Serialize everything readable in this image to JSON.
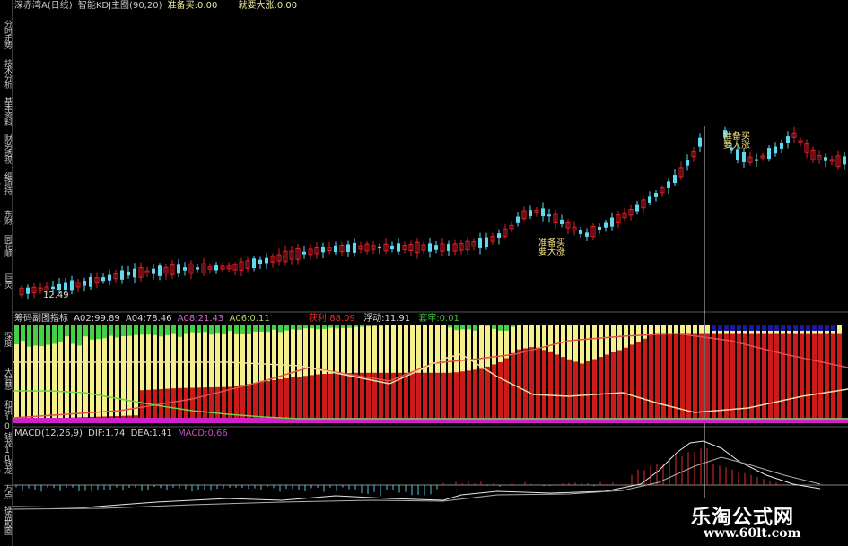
{
  "sidebar": {
    "items": [
      {
        "label": "分时走势"
      },
      {
        "label": "技术分析"
      },
      {
        "label": "基本资料"
      },
      {
        "label": "财务透视"
      },
      {
        "label": "细项持10"
      },
      {
        "label": "东财10"
      },
      {
        "label": "同花顺10"
      },
      {
        "label": "巨灵10"
      },
      {
        "label": "深度F10"
      },
      {
        "label": "大智慧"
      },
      {
        "label": "和讯10"
      },
      {
        "label": "钱龙10"
      },
      {
        "label": "钱龙10"
      },
      {
        "label": "万点"
      },
      {
        "label": "操盘股圈"
      }
    ]
  },
  "main_header": {
    "stock": "深赤湾A",
    "period": "(日线)",
    "indicator": "智能KDJ主图(90,20)",
    "buy_label": "准备买:",
    "buy_value": "0.00",
    "surge_label": "就要大涨:",
    "surge_value": "0.00"
  },
  "main_chart": {
    "price_low_label": "12.49",
    "signal_buy": "准备买",
    "signal_surge": "要大涨"
  },
  "chip_header": {
    "title": "筹码副图指标",
    "a02_label": "A02:",
    "a02_value": "99.89",
    "a04_label": "A04:",
    "a04_value": "78.46",
    "a08_label": "A08:",
    "a08_value": "21.43",
    "a06_label": "A06:",
    "a06_value": "0.11",
    "profit_label": "获利:",
    "profit_value": "88.09",
    "float_label": "浮动:",
    "float_value": "11.91",
    "trap_label": "套牢:",
    "trap_value": "0.01"
  },
  "macd_header": {
    "params": "MACD(12,26,9)",
    "dif_label": "DIF:",
    "dif_value": "1.74",
    "dea_label": "DEA:",
    "dea_value": "1.41",
    "macd_label": "MACD:",
    "macd_value": "0.66"
  },
  "watermark": {
    "title": "乐淘公式网",
    "url": "www.60lt.com"
  },
  "colors": {
    "up": "#e0202a",
    "down": "#5fd8f0",
    "yellow": "#f5f08c",
    "red_bar": "#cc1a1a",
    "green": "#44d044",
    "magenta": "#d020c8",
    "navy": "#1a1a9a"
  }
}
